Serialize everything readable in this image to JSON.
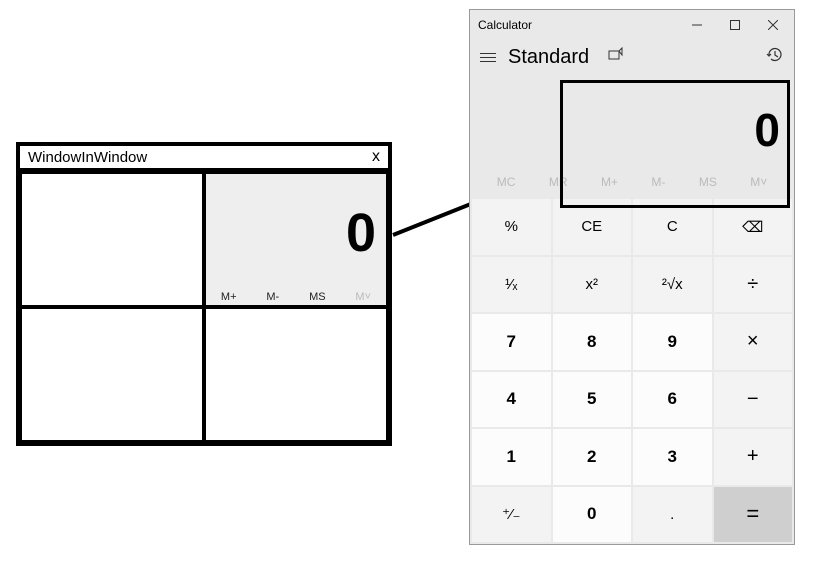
{
  "wiw": {
    "title": "WindowInWindow",
    "close": "x",
    "preview": {
      "display": "0",
      "mem": {
        "mplus": "M+",
        "mminus": "M-",
        "ms": "MS",
        "mlist": "M˅"
      }
    }
  },
  "calc": {
    "title": "Calculator",
    "mode": "Standard",
    "display": "0",
    "mem": {
      "mc": "MC",
      "mr": "MR",
      "mplus": "M+",
      "mminus": "M-",
      "ms": "MS",
      "mlist": "M˅"
    },
    "buttons": {
      "percent": "%",
      "ce": "CE",
      "c": "C",
      "back": "⌫",
      "recip": "¹⁄ₓ",
      "square": "x²",
      "sqrt": "²√x",
      "div": "÷",
      "n7": "7",
      "n8": "8",
      "n9": "9",
      "mul": "×",
      "n4": "4",
      "n5": "5",
      "n6": "6",
      "sub": "−",
      "n1": "1",
      "n2": "2",
      "n3": "3",
      "add": "+",
      "neg": "⁺⁄₋",
      "n0": "0",
      "dot": ".",
      "eq": "="
    }
  }
}
